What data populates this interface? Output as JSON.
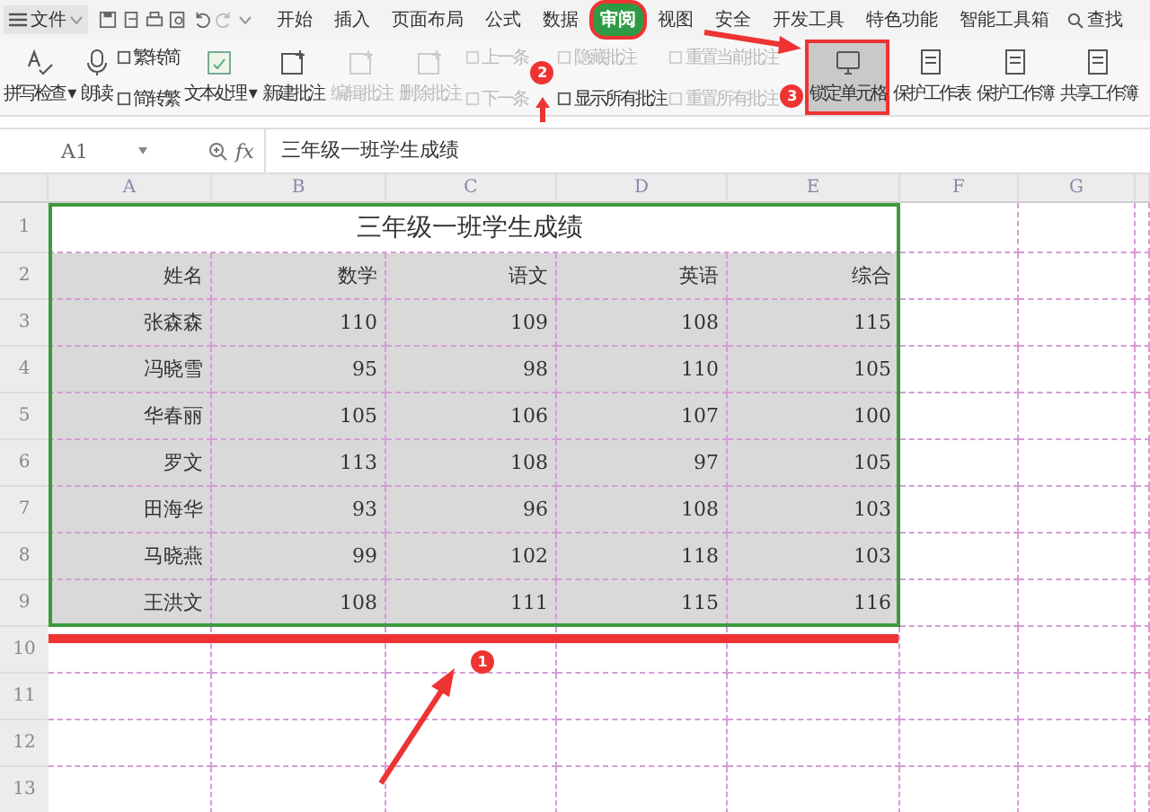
{
  "menu": {
    "file_label": "文件",
    "tabs": [
      {
        "label": "开始",
        "selected": false
      },
      {
        "label": "插入",
        "selected": false
      },
      {
        "label": "页面布局",
        "selected": false
      },
      {
        "label": "公式",
        "selected": false
      },
      {
        "label": "数据",
        "selected": false
      },
      {
        "label": "审阅",
        "selected": true
      },
      {
        "label": "视图",
        "selected": false
      },
      {
        "label": "安全",
        "selected": false
      },
      {
        "label": "开发工具",
        "selected": false
      },
      {
        "label": "特色功能",
        "selected": false
      },
      {
        "label": "智能工具箱",
        "selected": false
      }
    ],
    "search": "查找"
  },
  "ribbon": [
    {
      "kind": "large",
      "label": "拼写检查 ▾",
      "disabled": false,
      "highlighted": false
    },
    {
      "kind": "large",
      "label": "朗读",
      "disabled": false,
      "highlighted": false
    },
    {
      "kind": "stack",
      "items": [
        {
          "label": "繁转简",
          "disabled": false
        },
        {
          "label": "简转繁",
          "disabled": false
        }
      ]
    },
    {
      "kind": "large",
      "label": "文本处理 ▾",
      "disabled": false,
      "highlighted": false
    },
    {
      "kind": "large",
      "label": "新建批注",
      "disabled": false,
      "highlighted": false
    },
    {
      "kind": "large",
      "label": "编辑批注",
      "disabled": true,
      "highlighted": false
    },
    {
      "kind": "large",
      "label": "删除批注",
      "disabled": true,
      "highlighted": false
    },
    {
      "kind": "stack",
      "items": [
        {
          "label": "上一条",
          "disabled": true
        },
        {
          "label": "下一条",
          "disabled": true
        }
      ]
    },
    {
      "kind": "stack",
      "items": [
        {
          "label": "隐藏批注",
          "disabled": true
        },
        {
          "label": "显示所有批注",
          "disabled": false
        }
      ]
    },
    {
      "kind": "stack",
      "items": [
        {
          "label": "重置当前批注",
          "disabled": true
        },
        {
          "label": "重置所有批注",
          "disabled": true
        }
      ]
    },
    {
      "kind": "large",
      "label": "锁定单元格",
      "disabled": false,
      "highlighted": true
    },
    {
      "kind": "large",
      "label": "保护工作表",
      "disabled": false,
      "highlighted": false
    },
    {
      "kind": "large",
      "label": "保护工作簿",
      "disabled": false,
      "highlighted": false
    },
    {
      "kind": "large",
      "label": "共享工作簿",
      "disabled": false,
      "highlighted": false
    }
  ],
  "formula_bar": {
    "name_box": "A1",
    "fx": "fx",
    "value": "三年级一班学生成绩"
  },
  "columns": [
    "A",
    "B",
    "C",
    "D",
    "E",
    "F",
    "G"
  ],
  "row_numbers": [
    "1",
    "2",
    "3",
    "4",
    "5",
    "6",
    "7",
    "8",
    "9",
    "10",
    "11",
    "12",
    "13"
  ],
  "sheet": {
    "title": "三年级一班学生成绩",
    "headers": [
      "姓名",
      "数学",
      "语文",
      "英语",
      "综合"
    ],
    "records": [
      [
        "张森森",
        "110",
        "109",
        "108",
        "115"
      ],
      [
        "冯晓雪",
        "95",
        "98",
        "110",
        "105"
      ],
      [
        "华春丽",
        "105",
        "106",
        "107",
        "100"
      ],
      [
        "罗文",
        "113",
        "108",
        "97",
        "105"
      ],
      [
        "田海华",
        "93",
        "96",
        "108",
        "103"
      ],
      [
        "马晓燕",
        "99",
        "102",
        "118",
        "103"
      ],
      [
        "王洪文",
        "108",
        "111",
        "115",
        "116"
      ]
    ]
  },
  "annotations": [
    {
      "label": "1"
    },
    {
      "label": "2"
    },
    {
      "label": "3"
    }
  ]
}
